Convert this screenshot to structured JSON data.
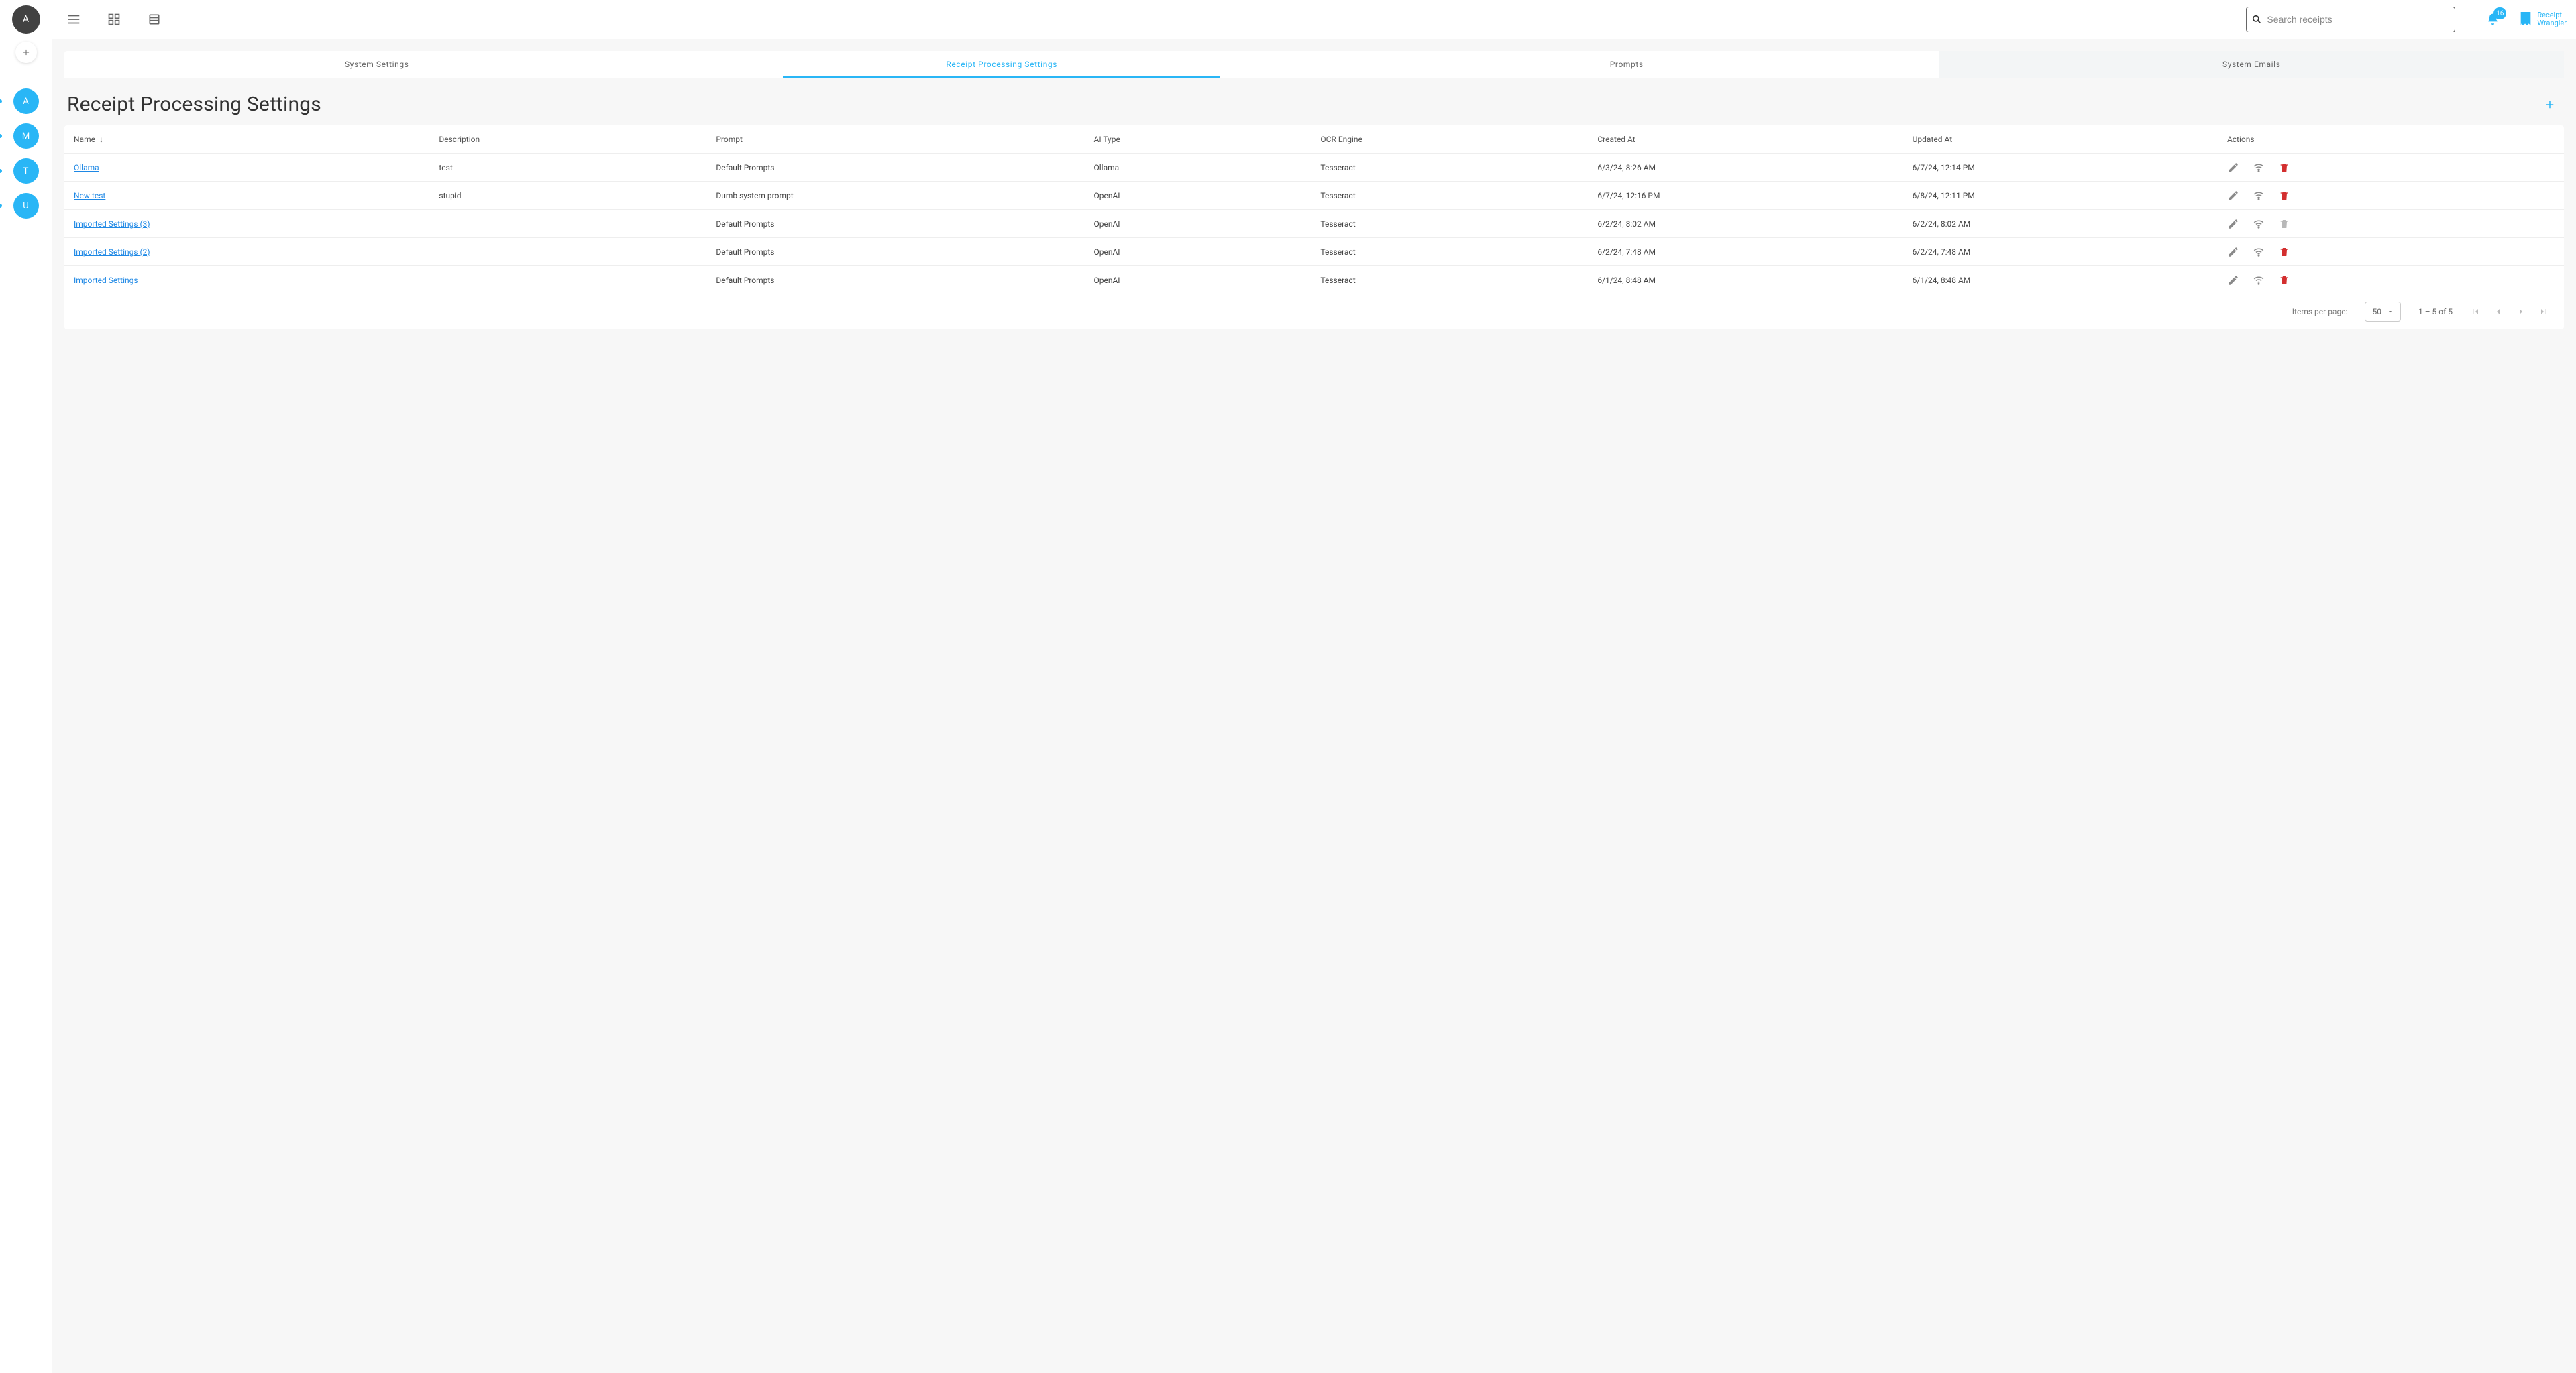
{
  "left_rail": {
    "avatar_letter": "A",
    "items": [
      {
        "letter": "A"
      },
      {
        "letter": "M"
      },
      {
        "letter": "T"
      },
      {
        "letter": "U"
      }
    ]
  },
  "topbar": {
    "search_placeholder": "Search receipts",
    "badge": "16",
    "brand_line1": "Receipt",
    "brand_line2": "Wrangler"
  },
  "tabs": [
    {
      "label": "System Settings",
      "active": false
    },
    {
      "label": "Receipt Processing Settings",
      "active": true
    },
    {
      "label": "Prompts",
      "active": false
    },
    {
      "label": "System Emails",
      "active": false,
      "hover": true
    }
  ],
  "page": {
    "title": "Receipt Processing Settings"
  },
  "table": {
    "columns": [
      "Name",
      "Description",
      "Prompt",
      "AI Type",
      "OCR Engine",
      "Created At",
      "Updated At",
      "Actions"
    ],
    "sort_column": "Name",
    "sort_dir": "desc",
    "rows": [
      {
        "name": "Ollama",
        "description": "test",
        "prompt": "Default Prompts",
        "ai_type": "Ollama",
        "ocr": "Tesseract",
        "created": "6/3/24, 8:26 AM",
        "updated": "6/7/24, 12:14 PM",
        "delete_disabled": false
      },
      {
        "name": "New test",
        "description": "stupid",
        "prompt": "Dumb system prompt",
        "ai_type": "OpenAI",
        "ocr": "Tesseract",
        "created": "6/7/24, 12:16 PM",
        "updated": "6/8/24, 12:11 PM",
        "delete_disabled": false
      },
      {
        "name": "Imported Settings (3)",
        "description": "",
        "prompt": "Default Prompts",
        "ai_type": "OpenAI",
        "ocr": "Tesseract",
        "created": "6/2/24, 8:02 AM",
        "updated": "6/2/24, 8:02 AM",
        "delete_disabled": true
      },
      {
        "name": "Imported Settings (2)",
        "description": "",
        "prompt": "Default Prompts",
        "ai_type": "OpenAI",
        "ocr": "Tesseract",
        "created": "6/2/24, 7:48 AM",
        "updated": "6/2/24, 7:48 AM",
        "delete_disabled": false
      },
      {
        "name": "Imported Settings",
        "description": "",
        "prompt": "Default Prompts",
        "ai_type": "OpenAI",
        "ocr": "Tesseract",
        "created": "6/1/24, 8:48 AM",
        "updated": "6/1/24, 8:48 AM",
        "delete_disabled": false
      }
    ]
  },
  "paginator": {
    "label": "Items per page:",
    "page_size": "50",
    "range": "1 – 5 of 5"
  }
}
